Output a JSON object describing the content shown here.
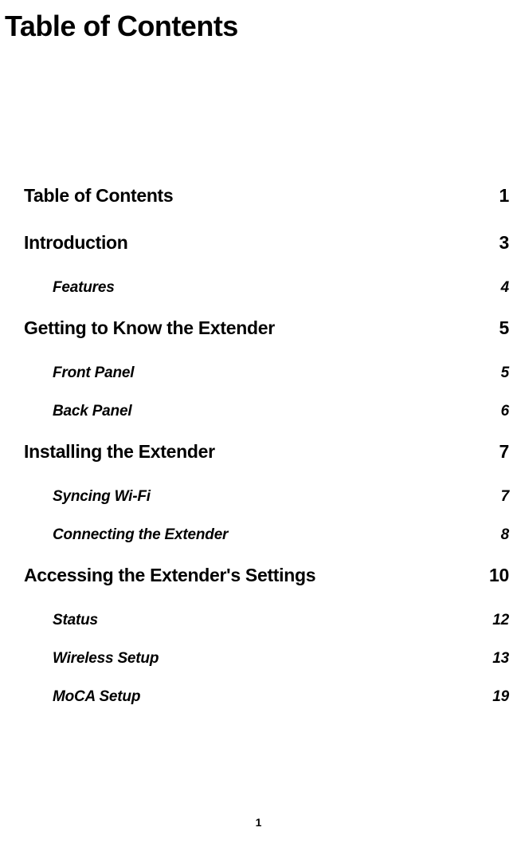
{
  "title": "Table of Contents",
  "page_number": "1",
  "toc": [
    {
      "level": 1,
      "label": "Table of Contents",
      "page": "1"
    },
    {
      "level": 1,
      "label": "Introduction",
      "page": "3"
    },
    {
      "level": 2,
      "label": "Features",
      "page": "4"
    },
    {
      "level": 1,
      "label": "Getting to Know the Extender",
      "page": "5"
    },
    {
      "level": 2,
      "label": "Front Panel",
      "page": "5"
    },
    {
      "level": 2,
      "label": "Back Panel",
      "page": "6"
    },
    {
      "level": 1,
      "label": "Installing the Extender",
      "page": "7"
    },
    {
      "level": 2,
      "label": "Syncing Wi-Fi",
      "page": "7"
    },
    {
      "level": 2,
      "label": "Connecting the Extender",
      "page": "8"
    },
    {
      "level": 1,
      "label": "Accessing the Extender's Settings",
      "page": "10"
    },
    {
      "level": 2,
      "label": "Status",
      "page": "12"
    },
    {
      "level": 2,
      "label": "Wireless Setup",
      "page": "13"
    },
    {
      "level": 2,
      "label": "MoCA Setup",
      "page": "19"
    }
  ]
}
